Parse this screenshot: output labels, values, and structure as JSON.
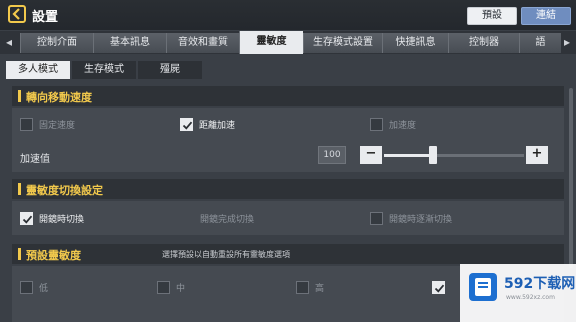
{
  "header": {
    "title": "設置",
    "default_label": "預設",
    "connect_label": "連結"
  },
  "tabs": [
    {
      "label": "控制介面",
      "active": false
    },
    {
      "label": "基本訊息",
      "active": false
    },
    {
      "label": "音效和畫質",
      "active": false
    },
    {
      "label": "靈敏度",
      "active": true
    },
    {
      "label": "生存模式設置",
      "active": false
    },
    {
      "label": "快捷訊息",
      "active": false
    },
    {
      "label": "控制器",
      "active": false
    },
    {
      "label": "語",
      "active": false
    }
  ],
  "subtabs": [
    {
      "label": "多人模式",
      "active": true
    },
    {
      "label": "生存模式",
      "active": false
    },
    {
      "label": "殭屍",
      "active": false
    }
  ],
  "turning": {
    "title": "轉向移動速度",
    "options": [
      {
        "label": "固定速度",
        "checked": false
      },
      {
        "label": "距離加速",
        "checked": true
      },
      {
        "label": "加速度",
        "checked": false
      }
    ],
    "accel_label": "加速值",
    "accel_value": "100",
    "minus": "−",
    "plus": "+",
    "slider_level": 0.35
  },
  "switching": {
    "title": "靈敏度切換設定",
    "options": [
      {
        "label": "開鏡時切換",
        "checked": true
      },
      {
        "label": "開鏡完成切換",
        "checked": false
      },
      {
        "label": "開鏡時逐漸切換",
        "checked": false
      }
    ]
  },
  "preset": {
    "title": "預設靈敏度",
    "note": "選擇預設以自動重設所有靈敏度選項",
    "options": [
      {
        "label": "低",
        "checked": false
      },
      {
        "label": "中",
        "checked": false
      },
      {
        "label": "高",
        "checked": false
      },
      {
        "label": "",
        "checked": true
      }
    ]
  },
  "watermark": {
    "text": "592下载网",
    "sub": "www.592xz.com"
  },
  "colors": {
    "accent": "#f2c94c",
    "connect": "#6f8dbf",
    "panel": "#454a51"
  }
}
